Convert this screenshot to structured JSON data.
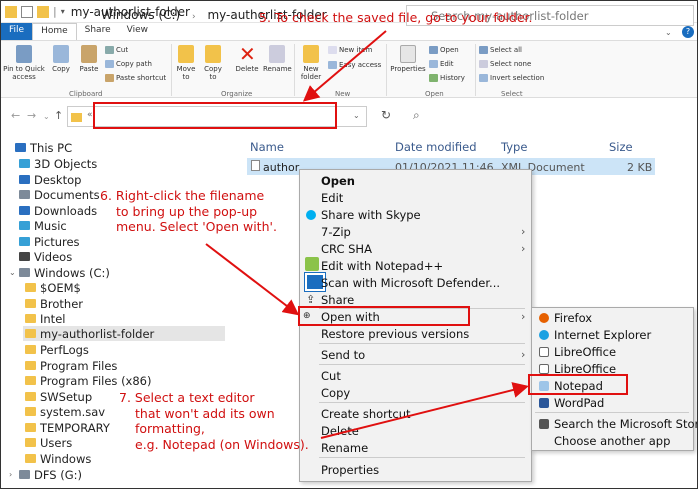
{
  "window": {
    "title": "my-authorlist-folder"
  },
  "ribbon_tabs": [
    "File",
    "Home",
    "Share",
    "View"
  ],
  "ribbon": {
    "pin": "Pin to Quick access",
    "copy": "Copy",
    "paste": "Paste",
    "cut": "Cut",
    "copy_path": "Copy path",
    "paste_shortcut": "Paste shortcut",
    "move_to": "Move to",
    "copy_to": "Copy to",
    "delete": "Delete",
    "rename": "Rename",
    "new_folder": "New folder",
    "new_item": "New item",
    "easy_access": "Easy access",
    "properties": "Properties",
    "open": "Open",
    "edit": "Edit",
    "history": "History",
    "select_all": "Select all",
    "select_none": "Select none",
    "invert_selection": "Invert selection",
    "groups": [
      "Clipboard",
      "Organize",
      "New",
      "Open",
      "Select"
    ]
  },
  "address": {
    "root": "Windows (C:)",
    "folder": "my-authorlist-folder",
    "search_placeholder": "Search my-authorlist-folder"
  },
  "tree": [
    "This PC",
    "3D Objects",
    "Desktop",
    "Documents",
    "Downloads",
    "Music",
    "Pictures",
    "Videos",
    "Windows (C:)",
    "$OEM$",
    "Brother",
    "Intel",
    "my-authorlist-folder",
    "PerfLogs",
    "Program Files",
    "Program Files (x86)",
    "SWSetup",
    "system.sav",
    "TEMPORARY",
    "Users",
    "Windows",
    "DFS (G:)"
  ],
  "columns": {
    "name": "Name",
    "date": "Date modified",
    "type": "Type",
    "size": "Size"
  },
  "file": {
    "name": "author",
    "date": "01/10/2021 11:46",
    "type": "XML Document",
    "size": "2 KB"
  },
  "context_menu": [
    "Open",
    "Edit",
    "Share with Skype",
    "7-Zip",
    "CRC SHA",
    "Edit with Notepad++",
    "Scan with Microsoft Defender...",
    "Share",
    "Open with",
    "Restore previous versions",
    "Send to",
    "Cut",
    "Copy",
    "Create shortcut",
    "Delete",
    "Rename",
    "Properties"
  ],
  "open_with": [
    "Firefox",
    "Internet Explorer",
    "LibreOffice",
    "LibreOffice",
    "Notepad",
    "WordPad",
    "Search the Microsoft Store",
    "Choose another app"
  ],
  "annotations": {
    "step5": "5. To check the saved file, go to your folder.",
    "step6": [
      "6. Right-click the filename",
      "to bring up the pop-up",
      "menu. Select 'Open with'."
    ],
    "step7": [
      "7. Select a text editor",
      "that won't add its own",
      "formatting,",
      "e.g. Notepad (on Windows)."
    ]
  },
  "colors": {
    "accent": "#1a6dbf",
    "annotation": "#d01010",
    "selection": "#cce4f7"
  }
}
